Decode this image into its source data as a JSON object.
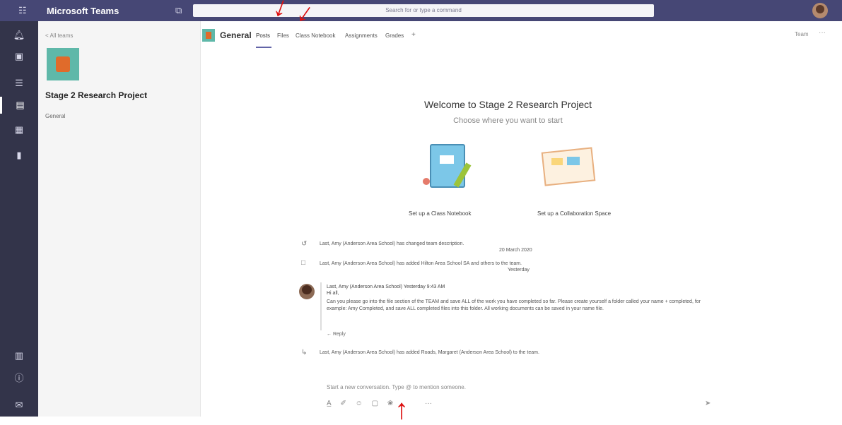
{
  "app": {
    "title": "Microsoft Teams"
  },
  "search": {
    "placeholder": "Search for or type a command"
  },
  "rail": {
    "items": [
      {
        "name": "activity-icon"
      },
      {
        "name": "chat-icon"
      },
      {
        "name": "teams-icon"
      },
      {
        "name": "assignments-icon"
      },
      {
        "name": "calendar-icon"
      },
      {
        "name": "files-icon"
      }
    ],
    "bottom": [
      {
        "name": "apps-icon"
      },
      {
        "name": "help-icon"
      },
      {
        "name": "feedback-icon"
      }
    ]
  },
  "team_pane": {
    "all_teams": "< All teams",
    "team_name": "Stage 2 Research Project",
    "channels": [
      "General"
    ]
  },
  "channel": {
    "title": "General",
    "tabs": [
      "Posts",
      "Files",
      "Class Notebook",
      "Assignments",
      "Grades"
    ],
    "team_link": "Team",
    "more": "···"
  },
  "welcome": {
    "title": "Welcome to Stage 2 Research Project",
    "subtitle": "Choose where you want to start",
    "button_notebook": "Set up a Class Notebook",
    "button_collab": "Set up a Collaboration Space"
  },
  "feed": {
    "event1": "Last, Amy (Anderson Area School) has changed team description.",
    "date1": "20 March 2020",
    "event2": "Last, Amy (Anderson Area School) has added Hilton Area School SA and others to the team.",
    "date2": "Yesterday",
    "message": {
      "head": "Last, Amy (Anderson Area School)   Yesterday 9:43 AM",
      "greeting": "Hi all,",
      "body": "Can you please go into the file section of the TEAM and save ALL of the work you have completed so far. Please create yourself a folder called your name + completed, for example: Amy Completed, and save ALL completed files into this folder. All working documents can be saved in your name file."
    },
    "reply": "← Reply",
    "event3": "Last, Amy (Anderson Area School) has added Roads, Margaret (Anderson Area School) to the team."
  },
  "compose": {
    "placeholder": "Start a new conversation. Type @ to mention someone.",
    "more": "···"
  }
}
